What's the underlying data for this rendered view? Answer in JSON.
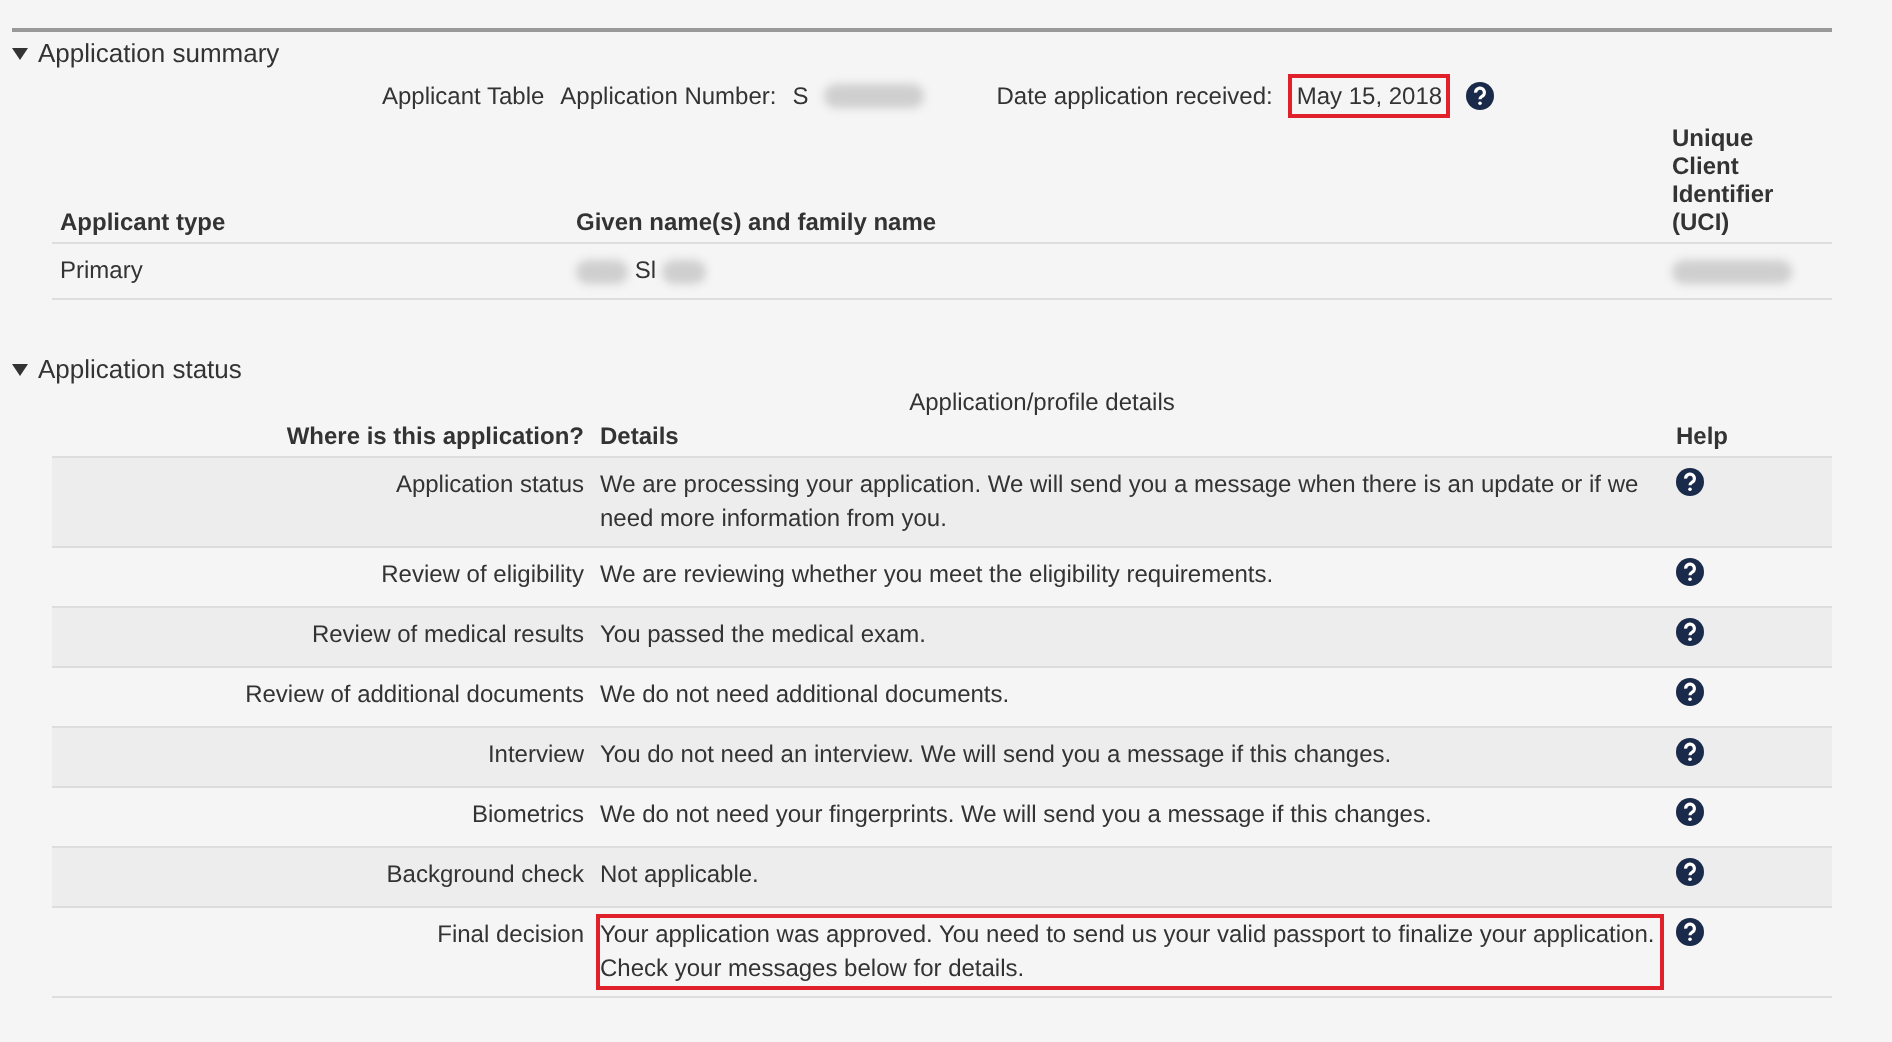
{
  "summary": {
    "label": "Application summary",
    "expanded": true,
    "caption": "Applicant Table",
    "number_label": "Application Number:",
    "number_value": "S",
    "date_label": "Date application received:",
    "date_value": "May 15, 2018",
    "date_highlighted": true,
    "columns": [
      "Applicant type",
      "Given name(s) and family name",
      "Unique Client Identifier (UCI)"
    ],
    "rows": [
      {
        "type": "Primary",
        "name": "Sl"
      }
    ]
  },
  "status": {
    "label": "Application status",
    "expanded": true,
    "caption": "Application/profile details",
    "columns": [
      "Where is this application?",
      "Details",
      "Help"
    ],
    "rows": [
      {
        "stage": "Application status",
        "details": "We are processing your application. We will send you a message when there is an update or if we need more information from you.",
        "highlighted": false
      },
      {
        "stage": "Review of eligibility",
        "details": "We are reviewing whether you meet the eligibility requirements.",
        "highlighted": false
      },
      {
        "stage": "Review of medical results",
        "details": "You passed the medical exam.",
        "highlighted": false
      },
      {
        "stage": "Review of additional documents",
        "details": "We do not need additional documents.",
        "highlighted": false
      },
      {
        "stage": "Interview",
        "details": "You do not need an interview. We will send you a message if this changes.",
        "highlighted": false
      },
      {
        "stage": "Biometrics",
        "details": "We do not need your fingerprints. We will send you a message if this changes.",
        "highlighted": false
      },
      {
        "stage": "Background check",
        "details": "Not applicable.",
        "highlighted": false
      },
      {
        "stage": "Final decision",
        "details": "Your application was approved. You need to send us your valid passport to finalize your application. Check your messages below for details.",
        "highlighted": true
      }
    ]
  }
}
